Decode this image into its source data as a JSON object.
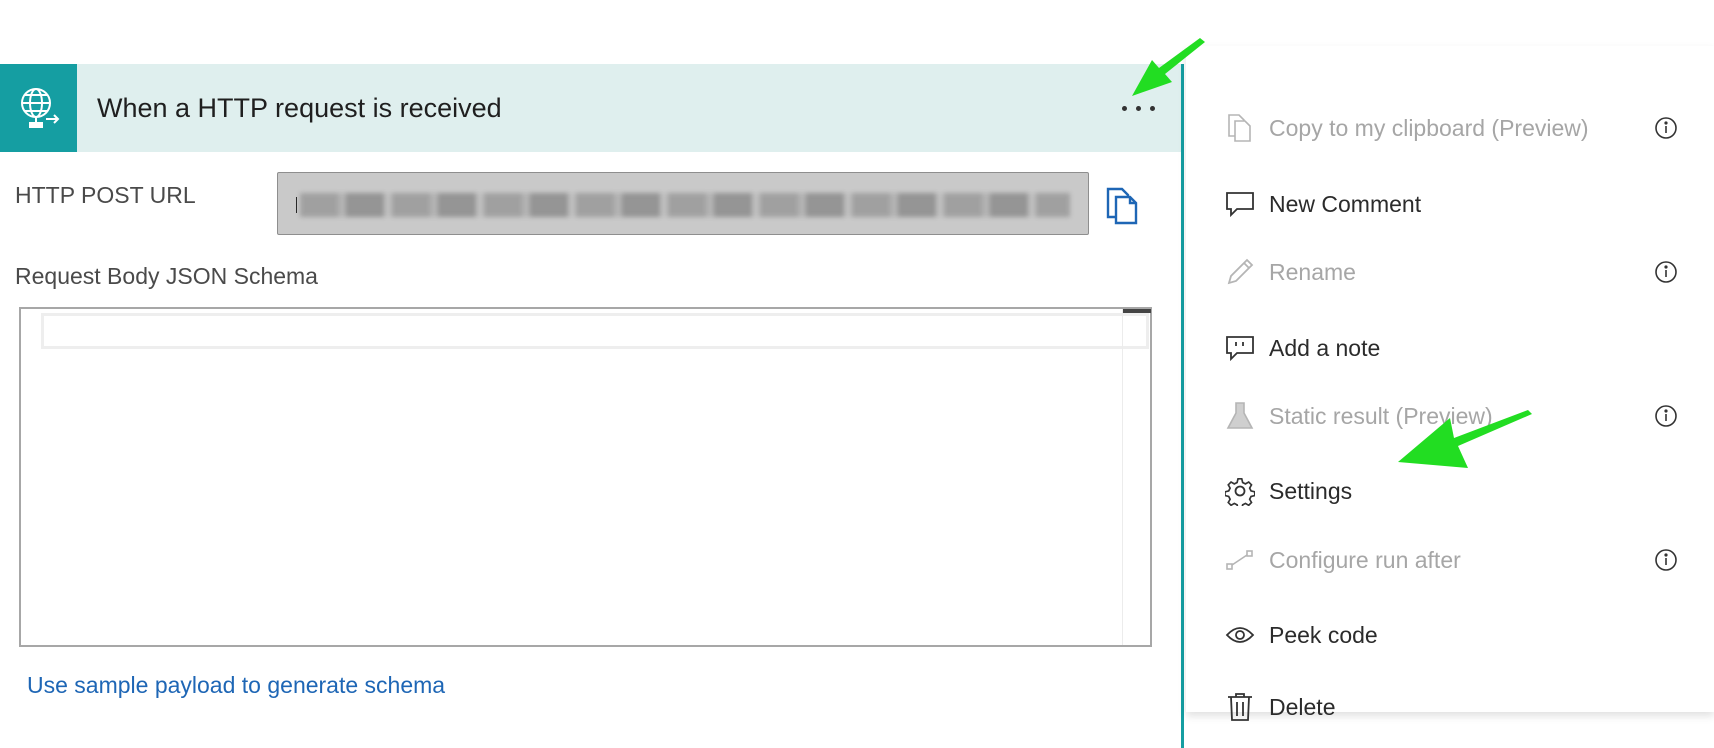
{
  "trigger": {
    "title": "When a HTTP request is received",
    "more_label": "...",
    "url_label": "HTTP POST URL",
    "url_value": "",
    "schema_label": "Request Body JSON Schema",
    "sample_link": "Use sample payload to generate schema",
    "icon": "globe-http-icon"
  },
  "context_menu": {
    "items": [
      {
        "label": "Copy to my clipboard (Preview)",
        "icon": "copy-icon",
        "disabled": true,
        "info": true
      },
      {
        "label": "New Comment",
        "icon": "comment-icon",
        "disabled": false,
        "info": false
      },
      {
        "label": "Rename",
        "icon": "pencil-icon",
        "disabled": true,
        "info": true
      },
      {
        "label": "Add a note",
        "icon": "note-icon",
        "disabled": false,
        "info": false
      },
      {
        "label": "Static result (Preview)",
        "icon": "flask-icon",
        "disabled": true,
        "info": true
      },
      {
        "label": "Settings",
        "icon": "gear-icon",
        "disabled": false,
        "info": false
      },
      {
        "label": "Configure run after",
        "icon": "run-after-icon",
        "disabled": true,
        "info": true
      },
      {
        "label": "Peek code",
        "icon": "eye-icon",
        "disabled": false,
        "info": false
      },
      {
        "label": "Delete",
        "icon": "trash-icon",
        "disabled": false,
        "info": false
      }
    ]
  },
  "colors": {
    "header_bg": "#dfefee",
    "accent_teal": "#159ea2",
    "link_blue": "#1e66b5",
    "disabled_text": "#a6a6a6",
    "annotation_green": "#22dd22"
  }
}
